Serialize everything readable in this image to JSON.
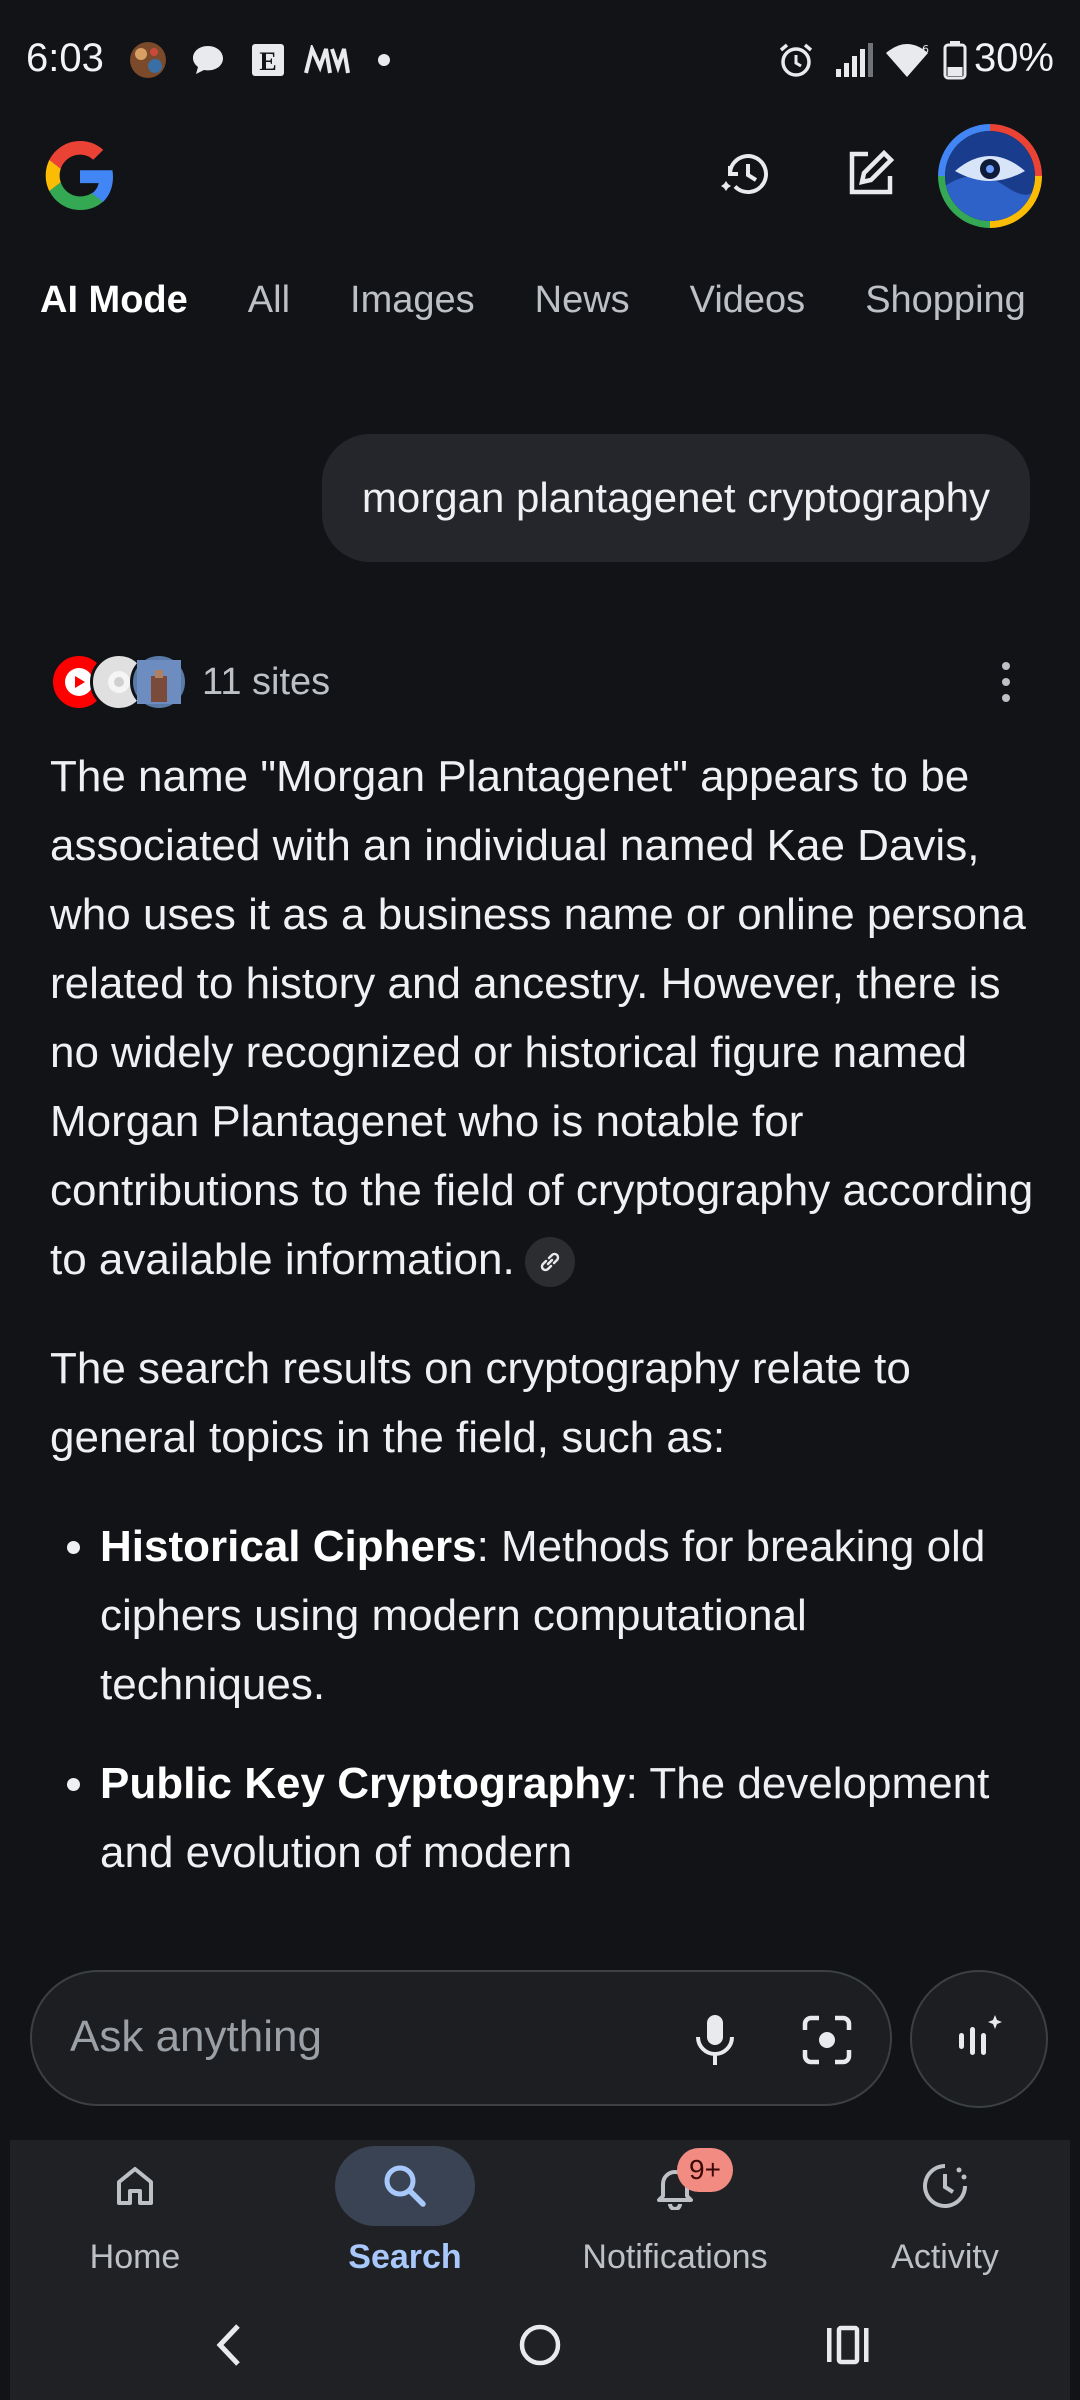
{
  "status_bar": {
    "time": "6:03",
    "battery_percent": "30%",
    "icons": [
      "photos-app-icon",
      "chat-bubble-icon",
      "newspaper-e-icon",
      "medium-icon",
      "dot-icon",
      "alarm-icon",
      "signal-icon",
      "wifi-icon",
      "battery-icon"
    ]
  },
  "header": {
    "logo": "google-g-logo",
    "actions": [
      "history-icon",
      "new-chat-icon",
      "account-avatar"
    ]
  },
  "tabs": [
    {
      "label": "AI Mode",
      "active": true
    },
    {
      "label": "All"
    },
    {
      "label": "Images"
    },
    {
      "label": "News"
    },
    {
      "label": "Videos"
    },
    {
      "label": "Shopping"
    }
  ],
  "query": "morgan plantagenet cryptography",
  "sources": {
    "label": "11 sites",
    "icons": [
      "youtube-icon",
      "source-icon",
      "site-thumbnail-icon"
    ]
  },
  "answer": {
    "p1": "The name \"Morgan Plantagenet\" appears to be associated with an individual named Kae Davis, who uses it as a business name or online persona related to history and ancestry. However, there is no widely recognized or historical figure named Morgan Plantagenet who is notable for contributions to the field of cryptography according to available information.",
    "p2": "The search results on cryptography relate to general topics in the field, such as:",
    "bullets": [
      {
        "title": "Historical Ciphers",
        "text": ": Methods for breaking old ciphers using modern computational techniques."
      },
      {
        "title": "Public Key Cryptography",
        "text": ": The development and evolution of modern"
      }
    ]
  },
  "ask_bar": {
    "placeholder": "Ask anything"
  },
  "bottom_nav": [
    {
      "label": "Home",
      "icon": "home-icon"
    },
    {
      "label": "Search",
      "icon": "search-icon",
      "active": true
    },
    {
      "label": "Notifications",
      "icon": "bell-icon",
      "badge": "9+"
    },
    {
      "label": "Activity",
      "icon": "activity-icon"
    }
  ],
  "colors": {
    "background": "#111317",
    "accent": "#a8c7fa",
    "badge": "#f28b82"
  }
}
